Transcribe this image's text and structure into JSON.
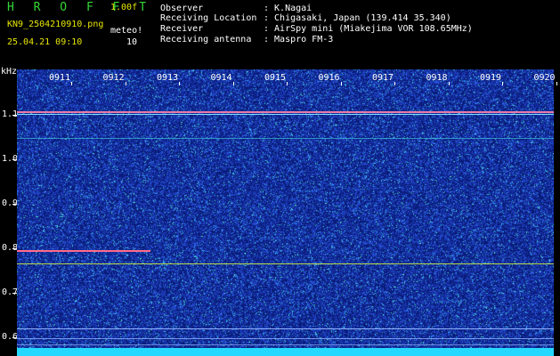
{
  "header": {
    "app_title": "H R O F F T",
    "version": "1.00f",
    "filename": "KN9_2504210910.png",
    "datetime": "25.04.21 09:10",
    "mode_label": "meteo!",
    "mode_value": "10",
    "info": [
      {
        "label": "Observer",
        "value": ": K.Nagai"
      },
      {
        "label": "Receiving Location",
        "value": ": Chigasaki, Japan (139.414 35.340)"
      },
      {
        "label": "Receiver",
        "value": ": AirSpy mini (Miakejima VOR 108.65MHz)"
      },
      {
        "label": "Receiving antenna",
        "value": ": Maspro FM-3"
      }
    ]
  },
  "spectrogram": {
    "y_unit": "kHz",
    "y_ticks": [
      "1.1",
      "1.0",
      "0.9",
      "0.8",
      "0.7",
      "0.6"
    ],
    "x_ticks": [
      "0911",
      "0912",
      "0913",
      "0914",
      "0915",
      "0916",
      "0917",
      "0918",
      "0919",
      "0920"
    ],
    "colors": {
      "background": "#0a1c7a",
      "noise_low": "#2f52e0",
      "noise_mid": "#32c8e8",
      "signal_high": "#ff3070",
      "bottom_band": "#24d8ff"
    }
  }
}
